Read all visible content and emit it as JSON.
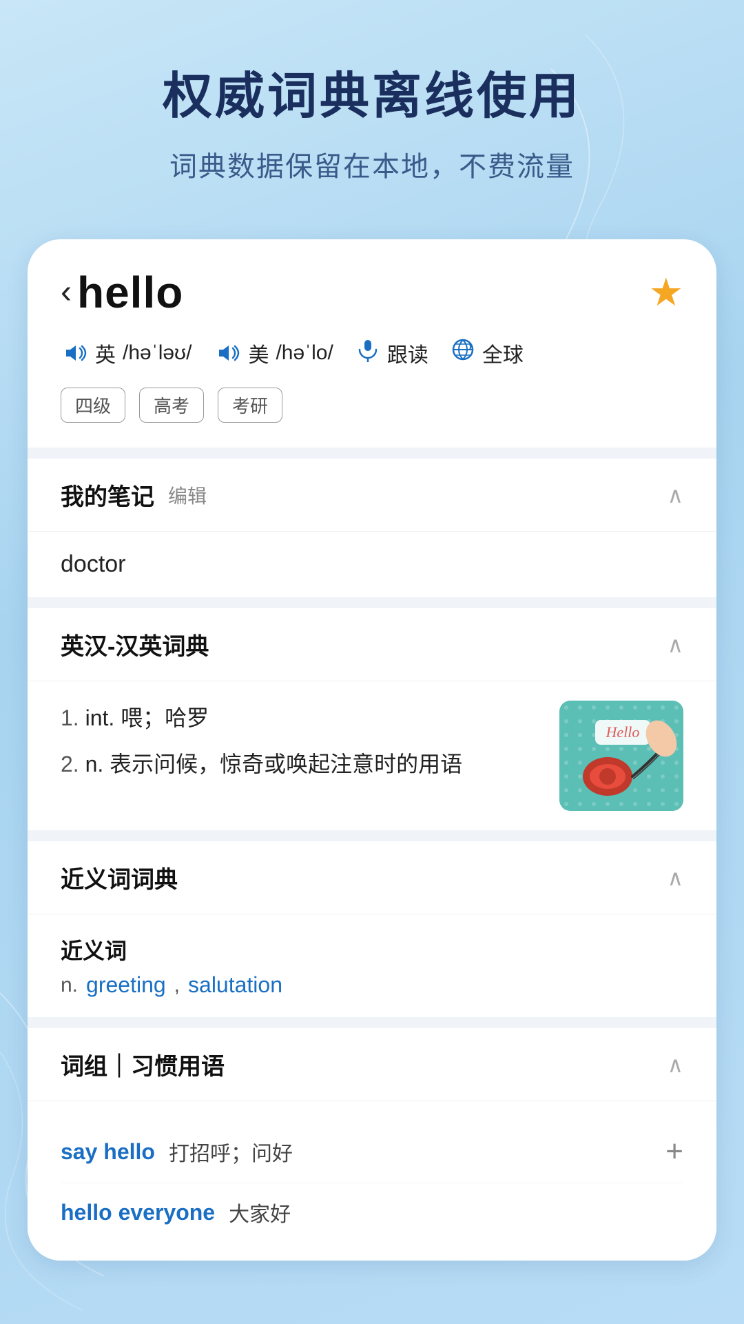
{
  "header": {
    "main_title": "权威词典离线使用",
    "sub_title": "词典数据保留在本地，不费流量"
  },
  "word_card": {
    "back_arrow": "‹",
    "word": "hello",
    "star": "★",
    "pronunciations": [
      {
        "lang": "英",
        "phonetic": "/həˈləʊ/"
      },
      {
        "lang": "美",
        "phonetic": "/həˈlo/"
      }
    ],
    "follow_label": "跟读",
    "global_label": "全球",
    "tags": [
      "四级",
      "高考",
      "考研"
    ]
  },
  "notes_section": {
    "title": "我的笔记",
    "edit_label": "编辑",
    "content": "doctor"
  },
  "dict_section": {
    "title": "英汉-汉英词典",
    "definitions": [
      {
        "num": "1.",
        "pos": "int.",
        "meaning": "喂；哈罗"
      },
      {
        "num": "2.",
        "pos": "n.",
        "meaning": "表示问候，惊奇或唤起注意时的用语"
      }
    ]
  },
  "synonym_section": {
    "title": "近义词词典",
    "category": "近义词",
    "part_of_speech": "n.",
    "synonyms": [
      "greeting",
      "salutation"
    ]
  },
  "phrases_section": {
    "title": "词组｜习惯用语",
    "phrases": [
      {
        "en": "say hello",
        "zh": "打招呼；问好",
        "has_add": true
      },
      {
        "en": "hello everyone",
        "zh": "大家好",
        "has_add": false
      }
    ]
  }
}
